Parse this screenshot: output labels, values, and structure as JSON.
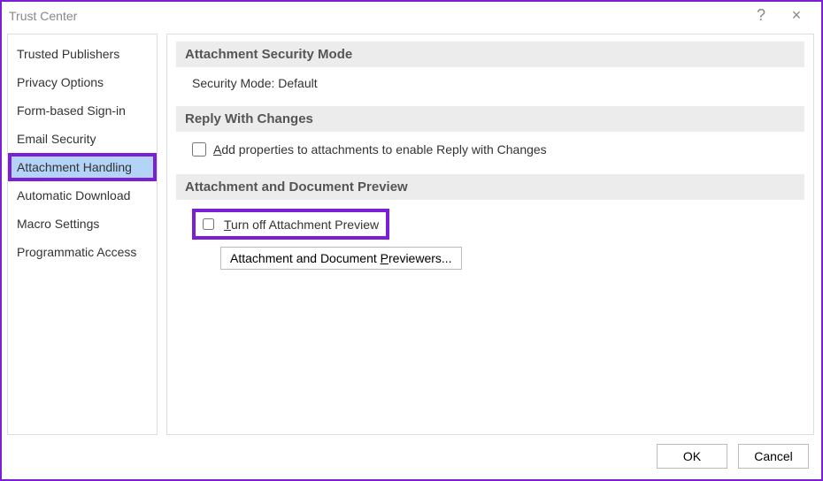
{
  "window": {
    "title": "Trust Center"
  },
  "sidebar": {
    "items": [
      {
        "label": "Trusted Publishers"
      },
      {
        "label": "Privacy Options"
      },
      {
        "label": "Form-based Sign-in"
      },
      {
        "label": "Email Security"
      },
      {
        "label": "Attachment Handling",
        "selected": true
      },
      {
        "label": "Automatic Download"
      },
      {
        "label": "Macro Settings"
      },
      {
        "label": "Programmatic Access"
      }
    ]
  },
  "sections": {
    "security_mode": {
      "header": "Attachment Security Mode",
      "text": "Security Mode: Default"
    },
    "reply_changes": {
      "header": "Reply With Changes",
      "checkbox_prefix": "A",
      "checkbox_rest": "dd properties to attachments to enable Reply with Changes",
      "checked": false
    },
    "preview": {
      "header": "Attachment and Document Preview",
      "checkbox_prefix": "T",
      "checkbox_rest": "urn off Attachment Preview",
      "checked": false,
      "button_part1": "Attachment and Document ",
      "button_key": "P",
      "button_part2": "reviewers..."
    }
  },
  "footer": {
    "ok": "OK",
    "cancel": "Cancel"
  }
}
